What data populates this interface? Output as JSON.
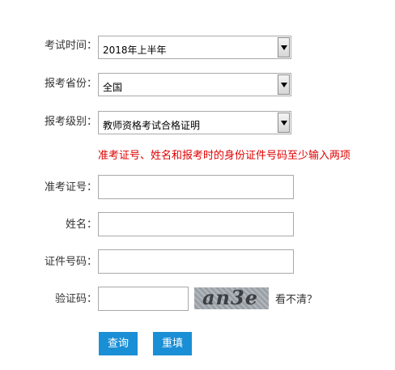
{
  "form": {
    "exam_time": {
      "label": "考试时间：",
      "value": "2018年上半年"
    },
    "province": {
      "label": "报考省份：",
      "value": "全国"
    },
    "level": {
      "label": "报考级别：",
      "value": "教师资格考试合格证明"
    },
    "notice": "准考证号、姓名和报考时的身份证件号码至少输入两项",
    "admission_no": {
      "label": "准考证号：",
      "value": ""
    },
    "name": {
      "label": "姓名：",
      "value": ""
    },
    "id_no": {
      "label": "证件号码：",
      "value": ""
    },
    "captcha": {
      "label": "验证码：",
      "value": "",
      "image_text": "an3e",
      "refresh_label": "看不清？"
    },
    "buttons": {
      "query": "查询",
      "reset": "重填"
    }
  },
  "colors": {
    "notice": "#e00000",
    "button": "#1a8fd6"
  }
}
